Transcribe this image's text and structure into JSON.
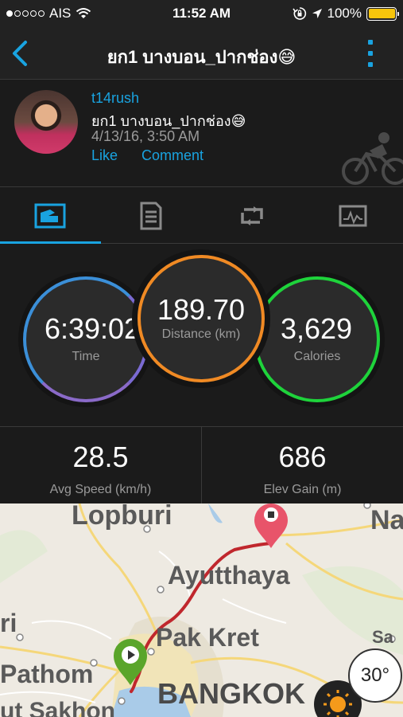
{
  "status_bar": {
    "carrier": "AIS",
    "time": "11:52 AM",
    "battery": "100%",
    "signal_bars_filled": 1,
    "signal_bars_total": 5
  },
  "nav": {
    "title": "ยก1 บางบอน_ปากช่อง😅"
  },
  "activity": {
    "username": "t14rush",
    "name": "ยก1 บางบอน_ปากช่อง😅",
    "date": "4/13/16, 3:50 AM",
    "like_label": "Like",
    "comment_label": "Comment",
    "type_icon": "cycling-icon"
  },
  "tabs": [
    {
      "name": "summary",
      "icon": "summary-icon",
      "active": true
    },
    {
      "name": "details",
      "icon": "details-icon",
      "active": false
    },
    {
      "name": "laps",
      "icon": "laps-icon",
      "active": false
    },
    {
      "name": "charts",
      "icon": "charts-icon",
      "active": false
    }
  ],
  "stats": {
    "time": {
      "value": "6:39:02",
      "label": "Time"
    },
    "distance": {
      "value": "189.70",
      "label": "Distance (km)"
    },
    "calories": {
      "value": "3,629",
      "label": "Calories"
    }
  },
  "summary": {
    "avg_speed": {
      "value": "28.5",
      "label": "Avg Speed (km/h)"
    },
    "elev_gain": {
      "value": "686",
      "label": "Elev Gain (m)"
    }
  },
  "map": {
    "labels": {
      "lopburi": "Lopburi",
      "na": "Na",
      "ayutthaya": "Ayutthaya",
      "ri": "ri",
      "pak_kret": "Pak Kret",
      "sa": "Sa",
      "pathom": "Pathom",
      "bangkok": "BANGKOK",
      "sakhon": "ut Sakhon"
    },
    "temperature": "30°"
  },
  "colors": {
    "accent": "#19a3e0",
    "time_ring": "#3b8fd8",
    "distance_ring": "#f08a24",
    "calories_ring": "#1ed33b",
    "route": "#c0272d",
    "start_marker": "#5aa52a",
    "end_marker": "#e8546a"
  }
}
